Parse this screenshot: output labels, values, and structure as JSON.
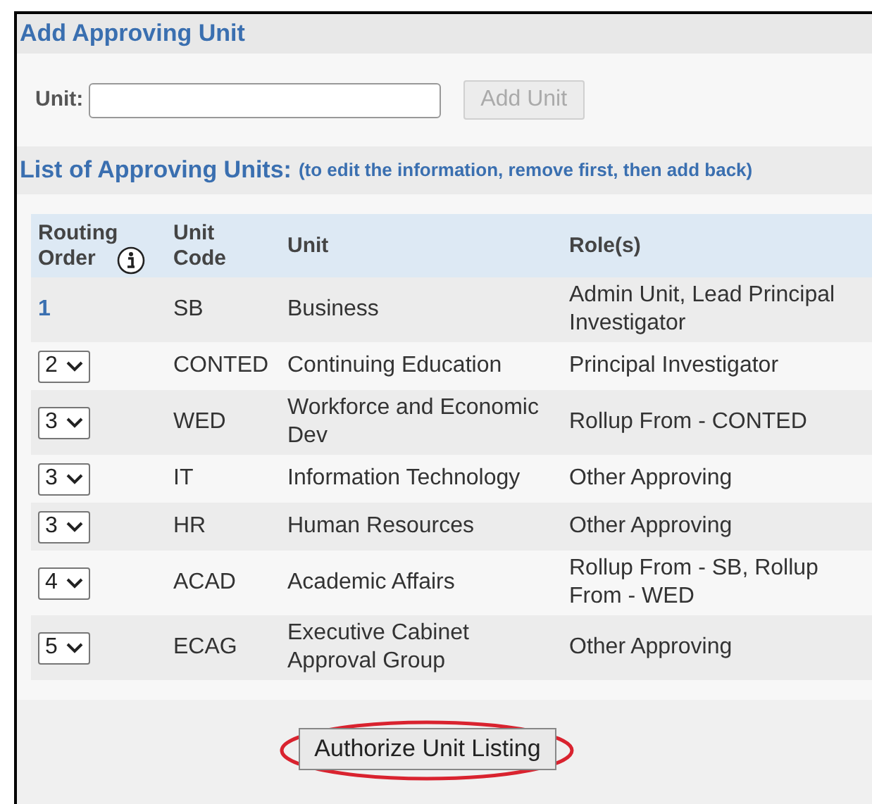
{
  "add_section": {
    "title": "Add Approving Unit",
    "unit_label": "Unit:",
    "add_button": {
      "label": "Add Unit",
      "disabled": true
    }
  },
  "list_section": {
    "title": "List of Approving Units:",
    "note": "(to edit the information, remove first, then add back)"
  },
  "table": {
    "columns": [
      "Routing Order",
      "Unit Code",
      "Unit",
      "Role(s)"
    ],
    "rows": [
      {
        "order": {
          "kind": "text",
          "value": "1"
        },
        "code": "SB",
        "unit": "Business",
        "roles": "Admin Unit, Lead Principal Investigator"
      },
      {
        "order": {
          "kind": "select",
          "value": "2"
        },
        "code": "CONTED",
        "unit": "Continuing Education",
        "roles": "Principal Investigator"
      },
      {
        "order": {
          "kind": "select",
          "value": "3"
        },
        "code": "WED",
        "unit": "Workforce and Economic Dev",
        "roles": "Rollup From - CONTED"
      },
      {
        "order": {
          "kind": "select",
          "value": "3"
        },
        "code": "IT",
        "unit": "Information Technology",
        "roles": "Other Approving"
      },
      {
        "order": {
          "kind": "select",
          "value": "3"
        },
        "code": "HR",
        "unit": "Human Resources",
        "roles": "Other Approving"
      },
      {
        "order": {
          "kind": "select",
          "value": "4"
        },
        "code": "ACAD",
        "unit": "Academic Affairs",
        "roles": "Rollup From - SB, Rollup From - WED"
      },
      {
        "order": {
          "kind": "select",
          "value": "5"
        },
        "code": "ECAG",
        "unit": "Executive Cabinet Approval Group",
        "roles": "Other Approving"
      }
    ]
  },
  "authorize_button": {
    "label": "Authorize Unit Listing",
    "highlighted": true
  }
}
